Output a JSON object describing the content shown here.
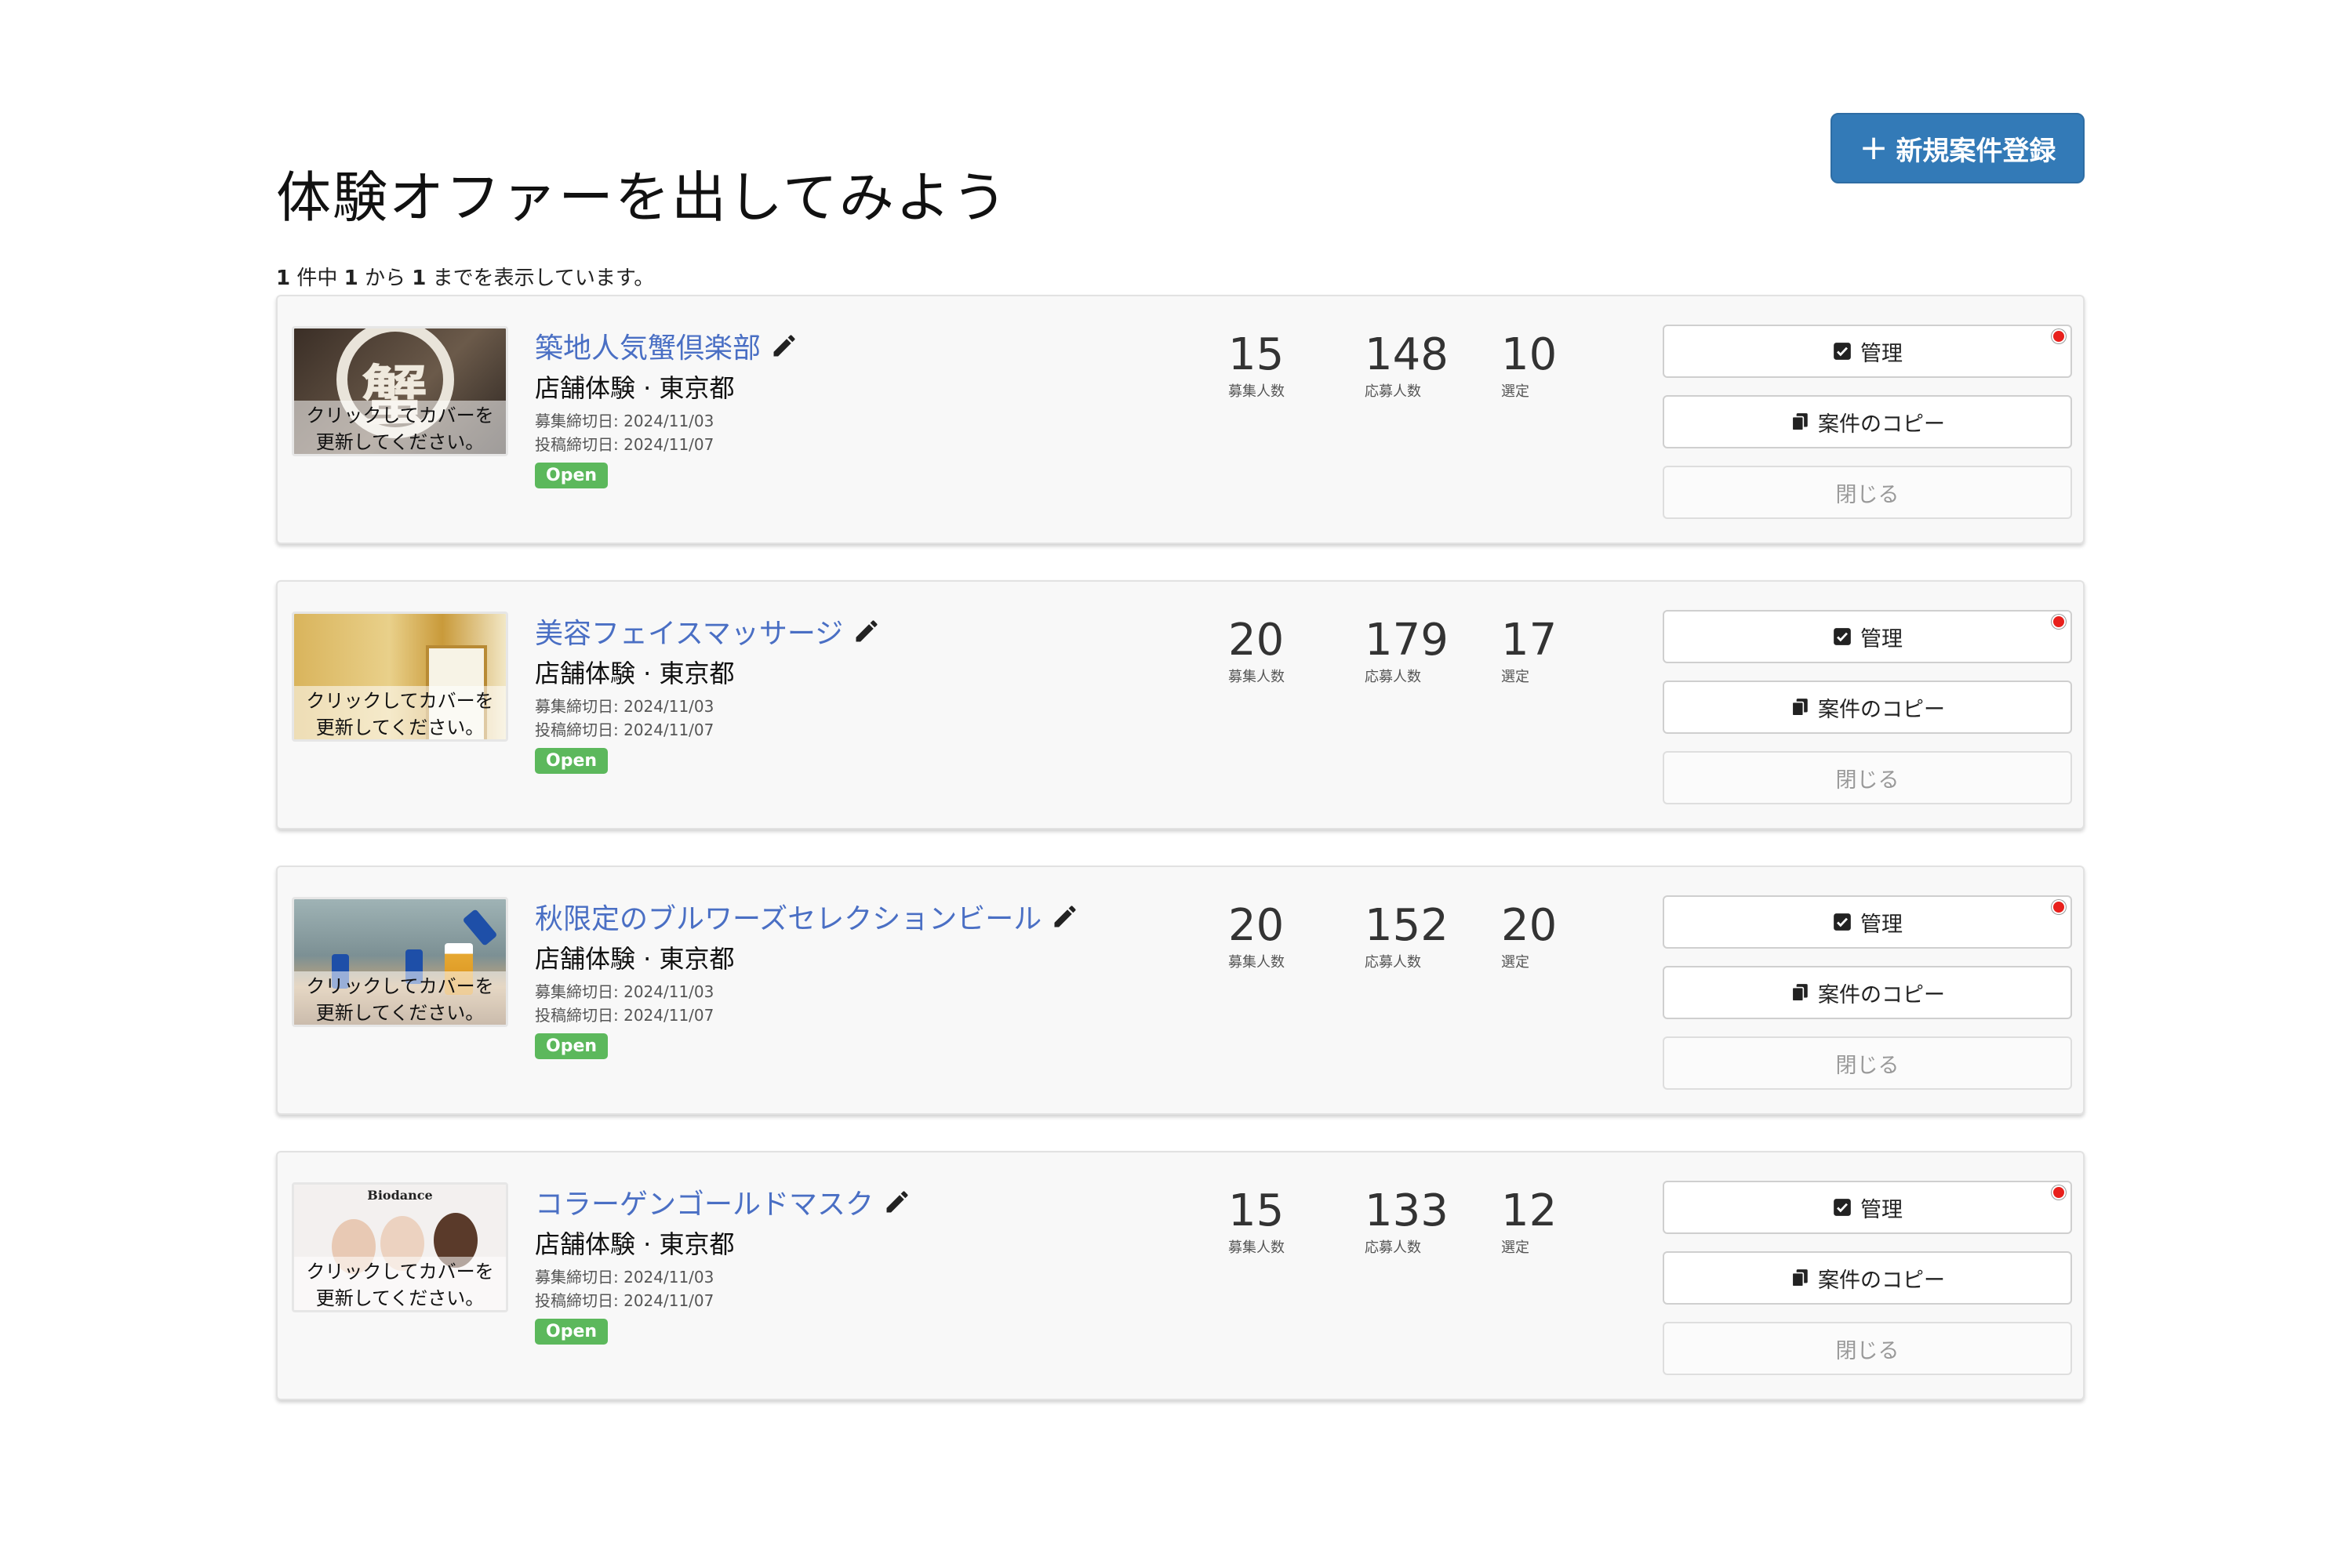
{
  "header": {
    "new_button_label": "新規案件登録",
    "page_title": "体験オファーを出してみよう"
  },
  "pagination": {
    "total": "1",
    "middle1": " 件中 ",
    "from": "1",
    "middle2": " から ",
    "to": "1",
    "suffix": " までを表示しています。"
  },
  "card_common": {
    "thumbnail_overlay": "クリックしてカバーを更新してください。",
    "edit_icon": "pencil-icon",
    "manage_label": "管理",
    "copy_label": "案件のコピー",
    "close_label": "閉じる",
    "stat_labels": [
      "募集人数",
      "応募人数",
      "選定"
    ],
    "status_color": "#5cb85c",
    "title_color": "#4a6fc4",
    "alert_color": "#e8201c"
  },
  "cards": [
    {
      "title": "築地人気蟹倶楽部",
      "type": "店舗体験 · 東京都",
      "recruit_deadline": "募集締切日: 2024/11/03",
      "post_deadline": "投稿締切日: 2024/11/07",
      "status": "Open",
      "recruit": "15",
      "applicants": "148",
      "selected": "10"
    },
    {
      "title": "美容フェイスマッサージ",
      "type": "店舗体験 · 東京都",
      "recruit_deadline": "募集締切日: 2024/11/03",
      "post_deadline": "投稿締切日: 2024/11/07",
      "status": "Open",
      "recruit": "20",
      "applicants": "179",
      "selected": "17"
    },
    {
      "title": "秋限定のブルワーズセレクションビール",
      "type": "店舗体験 · 東京都",
      "recruit_deadline": "募集締切日: 2024/11/03",
      "post_deadline": "投稿締切日: 2024/11/07",
      "status": "Open",
      "recruit": "20",
      "applicants": "152",
      "selected": "20"
    },
    {
      "title": "コラーゲンゴールドマスク",
      "type": "店舗体験 · 東京都",
      "recruit_deadline": "募集締切日: 2024/11/03",
      "post_deadline": "投稿締切日: 2024/11/07",
      "status": "Open",
      "recruit": "15",
      "applicants": "133",
      "selected": "12",
      "thumbnail_brand": "Biodance"
    }
  ]
}
